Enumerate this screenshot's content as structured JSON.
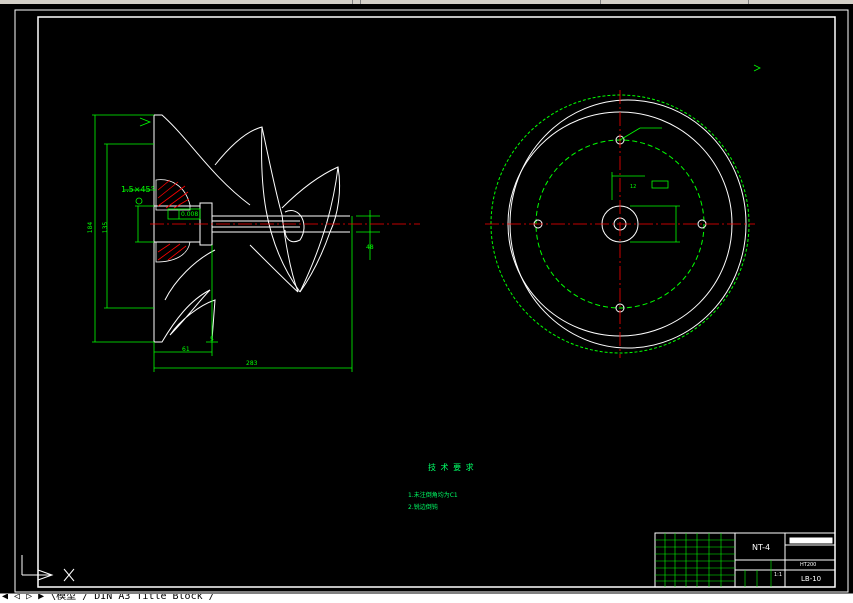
{
  "colors": {
    "background": "#000000",
    "frame": "#ffffff",
    "green": "#00ff00",
    "red": "#ff0000",
    "annotation": "#00ff66"
  },
  "drawing": {
    "dims": {
      "chamfer": "1.5×45°",
      "tolerance": "0.008",
      "overall_length": "283",
      "left_width": "61",
      "small": "5",
      "shaft": "48",
      "height_outer": "184",
      "height_inner": "135",
      "hub_height": "12"
    },
    "tech_requirements": {
      "title": "技 术 要 求",
      "items": [
        "1.未注倒角均为C1",
        "2.锐边倒钝"
      ]
    },
    "title_block": {
      "name_code": "NT-4",
      "drawing_no": "LB-10",
      "scale": "1:1",
      "material": "HT200"
    }
  },
  "tabs": [
    "◀ ◁ ▷ ▶ \\模型 / DIN A3 Title Block /"
  ]
}
